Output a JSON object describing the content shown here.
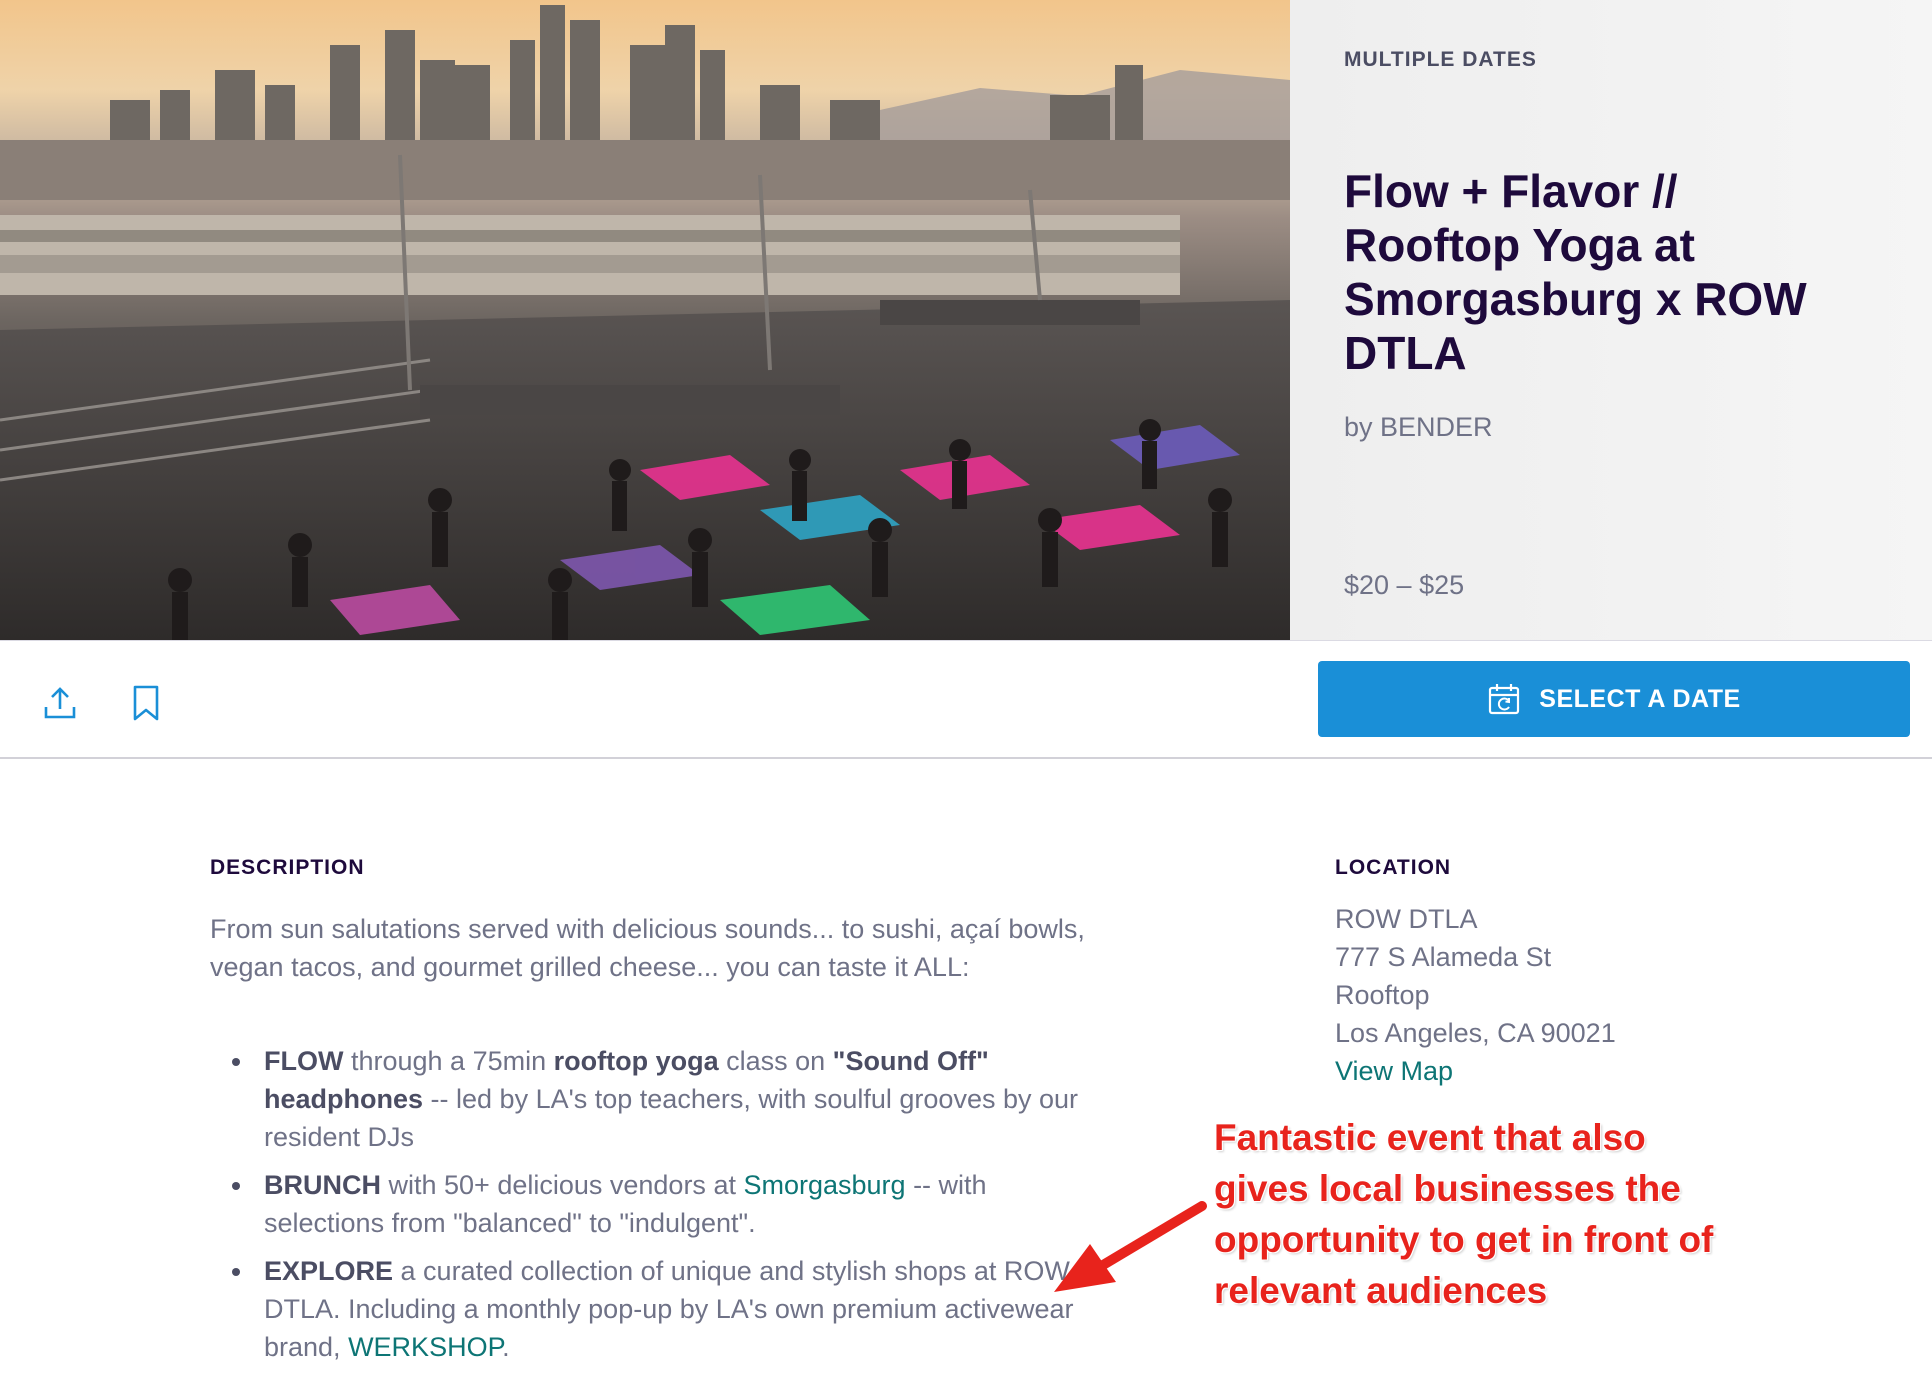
{
  "event": {
    "dates_label": "MULTIPLE DATES",
    "title": "Flow + Flavor // Rooftop Yoga at Smorgasburg x ROW DTLA",
    "organizer": "by BENDER",
    "price": "$20 – $25",
    "hero_image": "rooftop-yoga-photo"
  },
  "actions": {
    "share_icon": "share-icon",
    "bookmark_icon": "bookmark-icon",
    "select_date_label": "SELECT A DATE",
    "calendar_icon": "calendar-icon",
    "accent_color": "#1a8fd7"
  },
  "description": {
    "heading": "DESCRIPTION",
    "intro": "From sun salutations served with delicious sounds... to sushi, açaí bowls, vegan tacos, and gourmet grilled cheese... you can taste it ALL:",
    "bullets": [
      {
        "b1": "FLOW",
        "t1": " through a 75min ",
        "b2": "rooftop yoga",
        "t2": " class on ",
        "b3": "\"Sound Off\" headphones",
        "t3": " -- led by LA's top teachers, with soulful grooves by our resident DJs"
      },
      {
        "b1": "BRUNCH",
        "t1": " with 50+ delicious vendors at ",
        "link": "Smorgasburg",
        "t2": " -- with selections from \"balanced\" to \"indulgent\"."
      },
      {
        "b1": "EXPLORE",
        "t1": " a curated collection of unique and stylish shops at ROW DTLA. Including a monthly pop-up by LA's own premium activewear brand, ",
        "link": "WERKSHOP",
        "t2": "."
      }
    ]
  },
  "location": {
    "heading": "LOCATION",
    "lines": [
      "ROW DTLA",
      "777 S Alameda St",
      "Rooftop",
      "Los Angeles, CA 90021"
    ],
    "map_link": "View Map"
  },
  "annotation": {
    "text": "Fantastic event that also gives local businesses the opportunity to get in front of relevant audiences",
    "color": "#e8231c"
  }
}
